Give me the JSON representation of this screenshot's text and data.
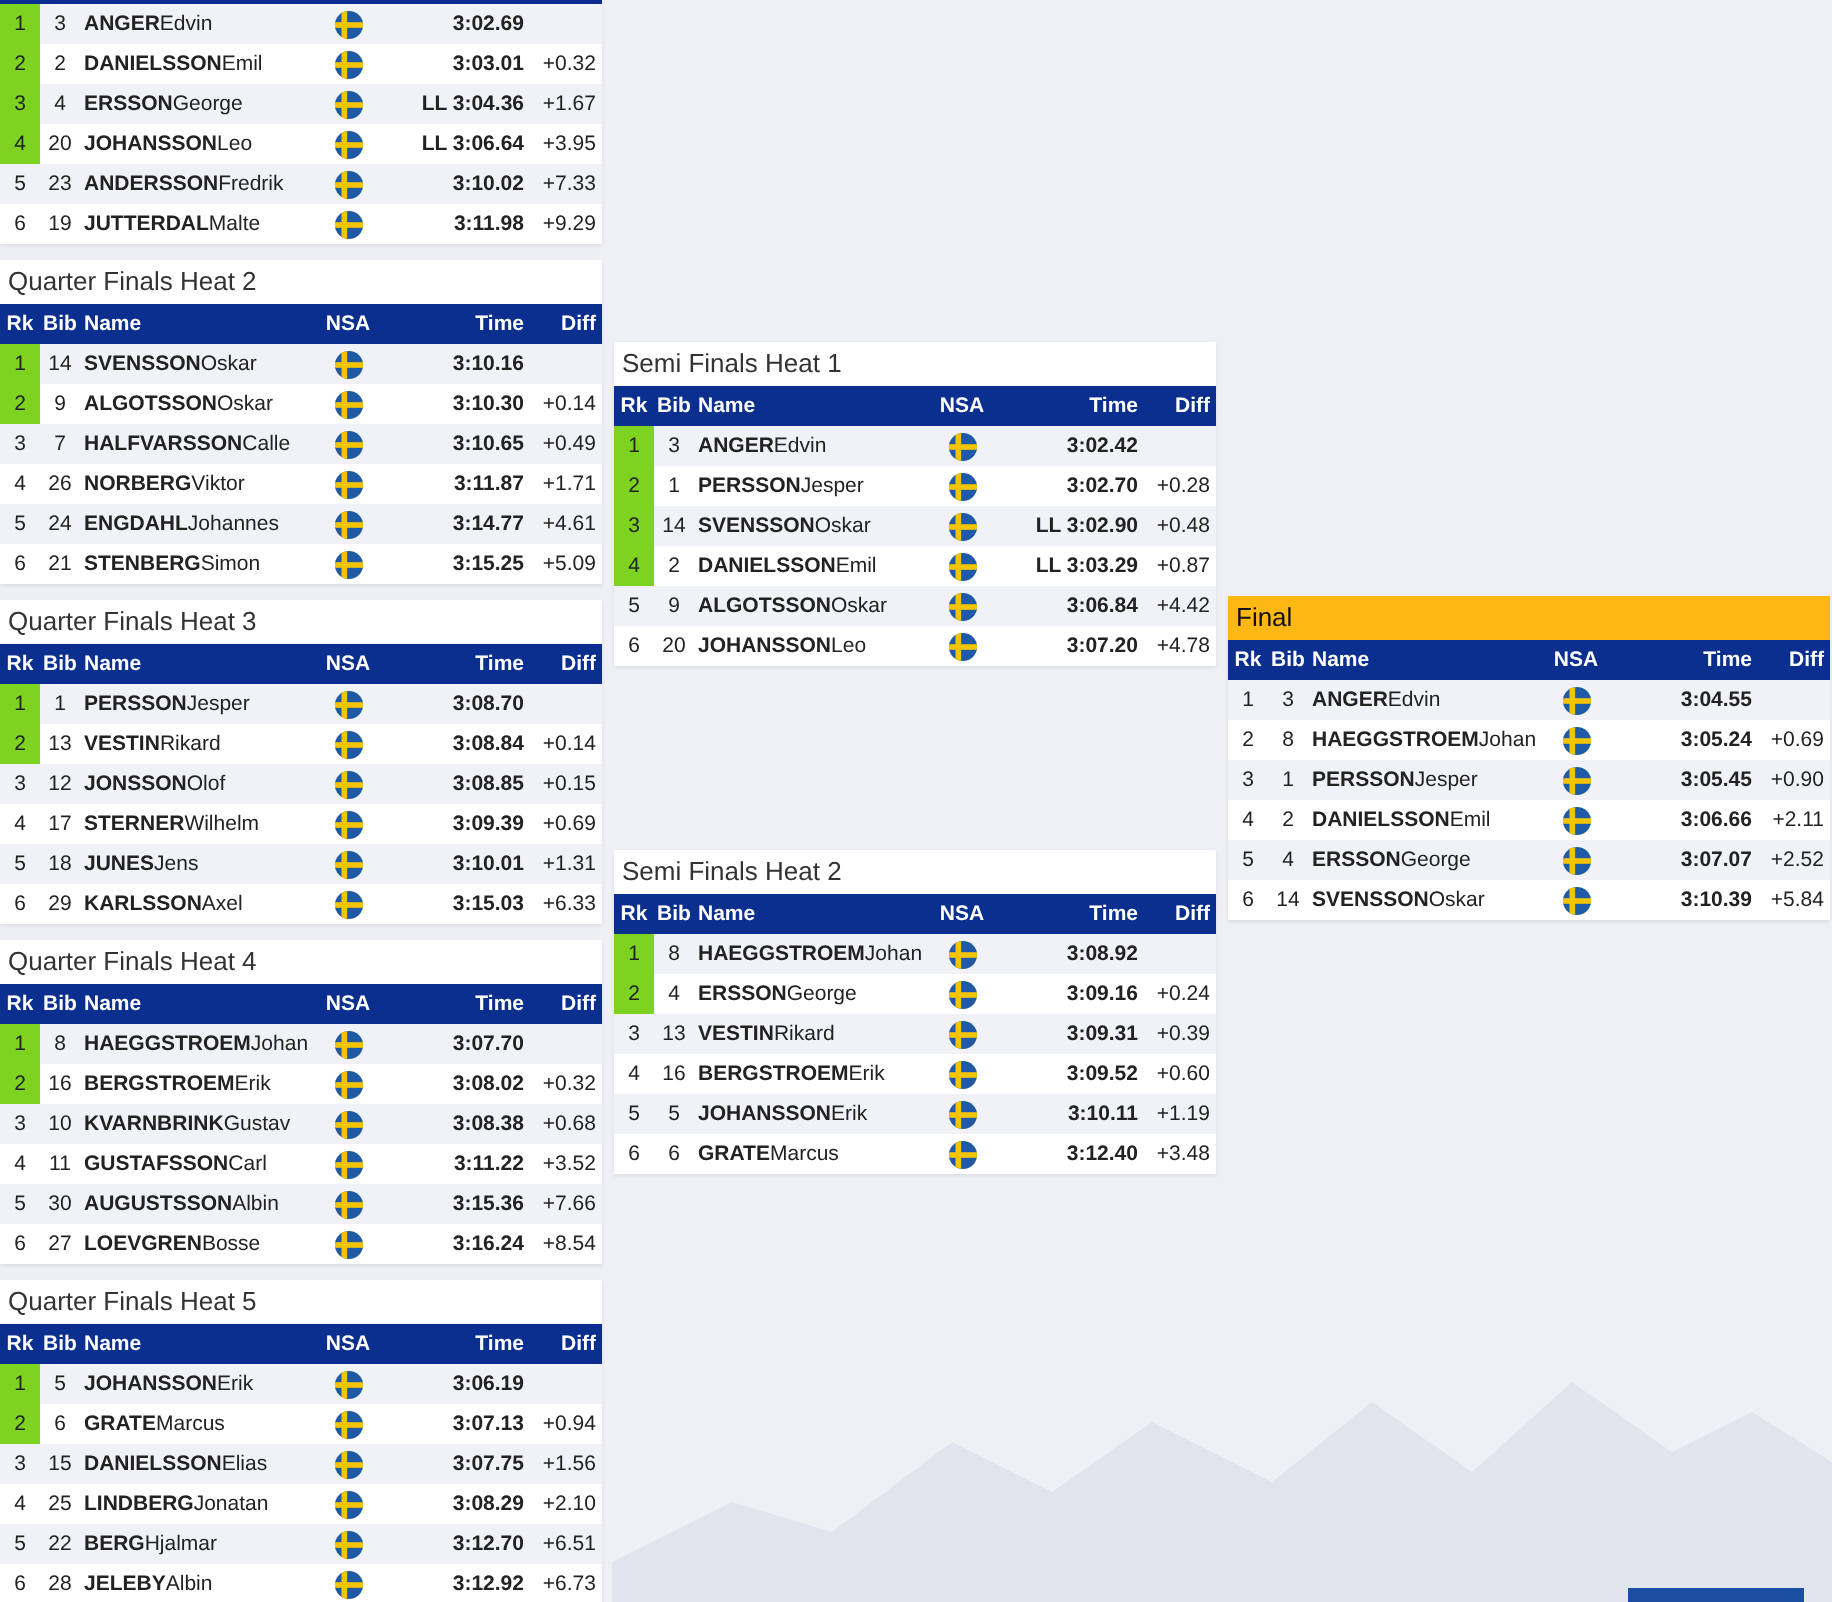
{
  "columns": [
    {
      "heats": [
        {
          "rows": [
            {
              "rank": "1",
              "bib": "3",
              "last": "ANGER",
              "first": "Edvin",
              "time": "3:02.69",
              "qualified": true
            },
            {
              "rank": "2",
              "bib": "2",
              "last": "DANIELSSON",
              "first": "Emil",
              "time": "3:03.01",
              "diff": "+0.32",
              "qualified": true
            },
            {
              "rank": "3",
              "bib": "4",
              "last": "ERSSON",
              "first": "George",
              "note": "LL",
              "time": "3:04.36",
              "diff": "+1.67",
              "qualified": true
            },
            {
              "rank": "4",
              "bib": "20",
              "last": "JOHANSSON",
              "first": "Leo",
              "note": "LL",
              "time": "3:06.64",
              "diff": "+3.95",
              "qualified": true
            },
            {
              "rank": "5",
              "bib": "23",
              "last": "ANDERSSON",
              "first": "Fredrik",
              "time": "3:10.02",
              "diff": "+7.33",
              "qualified": false
            },
            {
              "rank": "6",
              "bib": "19",
              "last": "JUTTERDAL",
              "first": "Malte",
              "time": "3:11.98",
              "diff": "+9.29",
              "qualified": false
            }
          ]
        },
        {
          "kind": "heat",
          "title": "Quarter Finals Heat 2",
          "columns": [
            "Rk",
            "Bib",
            "Name",
            "NSA",
            "Time",
            "Diff"
          ],
          "rows": [
            {
              "rank": "1",
              "bib": "14",
              "last": "SVENSSON",
              "first": "Oskar",
              "time": "3:10.16",
              "qualified": true
            },
            {
              "rank": "2",
              "bib": "9",
              "last": "ALGOTSSON",
              "first": "Oskar",
              "time": "3:10.30",
              "diff": "+0.14",
              "qualified": true
            },
            {
              "rank": "3",
              "bib": "7",
              "last": "HALFVARSSON",
              "first": "Calle",
              "time": "3:10.65",
              "diff": "+0.49",
              "qualified": false
            },
            {
              "rank": "4",
              "bib": "26",
              "last": "NORBERG",
              "first": "Viktor",
              "time": "3:11.87",
              "diff": "+1.71",
              "qualified": false
            },
            {
              "rank": "5",
              "bib": "24",
              "last": "ENGDAHL",
              "first": "Johannes",
              "time": "3:14.77",
              "diff": "+4.61",
              "qualified": false
            },
            {
              "rank": "6",
              "bib": "21",
              "last": "STENBERG",
              "first": "Simon",
              "time": "3:15.25",
              "diff": "+5.09",
              "qualified": false
            }
          ]
        },
        {
          "kind": "heat",
          "title": "Quarter Finals Heat 3",
          "columns": [
            "Rk",
            "Bib",
            "Name",
            "NSA",
            "Time",
            "Diff"
          ],
          "rows": [
            {
              "rank": "1",
              "bib": "1",
              "last": "PERSSON",
              "first": "Jesper",
              "time": "3:08.70",
              "qualified": true
            },
            {
              "rank": "2",
              "bib": "13",
              "last": "VESTIN",
              "first": "Rikard",
              "time": "3:08.84",
              "diff": "+0.14",
              "qualified": true
            },
            {
              "rank": "3",
              "bib": "12",
              "last": "JONSSON",
              "first": "Olof",
              "time": "3:08.85",
              "diff": "+0.15",
              "qualified": false
            },
            {
              "rank": "4",
              "bib": "17",
              "last": "STERNER",
              "first": "Wilhelm",
              "time": "3:09.39",
              "diff": "+0.69",
              "qualified": false
            },
            {
              "rank": "5",
              "bib": "18",
              "last": "JUNES",
              "first": "Jens",
              "time": "3:10.01",
              "diff": "+1.31",
              "qualified": false
            },
            {
              "rank": "6",
              "bib": "29",
              "last": "KARLSSON",
              "first": "Axel",
              "time": "3:15.03",
              "diff": "+6.33",
              "qualified": false
            }
          ]
        },
        {
          "kind": "heat",
          "title": "Quarter Finals Heat 4",
          "columns": [
            "Rk",
            "Bib",
            "Name",
            "NSA",
            "Time",
            "Diff"
          ],
          "rows": [
            {
              "rank": "1",
              "bib": "8",
              "last": "HAEGGSTROEM",
              "first": "Johan",
              "time": "3:07.70",
              "qualified": true
            },
            {
              "rank": "2",
              "bib": "16",
              "last": "BERGSTROEM",
              "first": "Erik",
              "time": "3:08.02",
              "diff": "+0.32",
              "qualified": true
            },
            {
              "rank": "3",
              "bib": "10",
              "last": "KVARNBRINK",
              "first": "Gustav",
              "time": "3:08.38",
              "diff": "+0.68",
              "qualified": false
            },
            {
              "rank": "4",
              "bib": "11",
              "last": "GUSTAFSSON",
              "first": "Carl",
              "time": "3:11.22",
              "diff": "+3.52",
              "qualified": false
            },
            {
              "rank": "5",
              "bib": "30",
              "last": "AUGUSTSSON",
              "first": "Albin",
              "time": "3:15.36",
              "diff": "+7.66",
              "qualified": false
            },
            {
              "rank": "6",
              "bib": "27",
              "last": "LOEVGREN",
              "first": "Bosse",
              "time": "3:16.24",
              "diff": "+8.54",
              "qualified": false
            }
          ]
        },
        {
          "kind": "heat",
          "title": "Quarter Finals Heat 5",
          "columns": [
            "Rk",
            "Bib",
            "Name",
            "NSA",
            "Time",
            "Diff"
          ],
          "rows": [
            {
              "rank": "1",
              "bib": "5",
              "last": "JOHANSSON",
              "first": "Erik",
              "time": "3:06.19",
              "qualified": true
            },
            {
              "rank": "2",
              "bib": "6",
              "last": "GRATE",
              "first": "Marcus",
              "time": "3:07.13",
              "diff": "+0.94",
              "qualified": true
            },
            {
              "rank": "3",
              "bib": "15",
              "last": "DANIELSSON",
              "first": "Elias",
              "time": "3:07.75",
              "diff": "+1.56",
              "qualified": false
            },
            {
              "rank": "4",
              "bib": "25",
              "last": "LINDBERG",
              "first": "Jonatan",
              "time": "3:08.29",
              "diff": "+2.10",
              "qualified": false
            },
            {
              "rank": "5",
              "bib": "22",
              "last": "BERG",
              "first": "Hjalmar",
              "time": "3:12.70",
              "diff": "+6.51",
              "qualified": false
            },
            {
              "rank": "6",
              "bib": "28",
              "last": "JELEBY",
              "first": "Albin",
              "time": "3:12.92",
              "diff": "+6.73",
              "qualified": false
            }
          ]
        }
      ]
    },
    {
      "heats": [
        {
          "kind": "heat",
          "title": "Semi Finals Heat 1",
          "columns": [
            "Rk",
            "Bib",
            "Name",
            "NSA",
            "Time",
            "Diff"
          ],
          "rows": [
            {
              "rank": "1",
              "bib": "3",
              "last": "ANGER",
              "first": "Edvin",
              "time": "3:02.42",
              "qualified": true
            },
            {
              "rank": "2",
              "bib": "1",
              "last": "PERSSON",
              "first": "Jesper",
              "time": "3:02.70",
              "diff": "+0.28",
              "qualified": true
            },
            {
              "rank": "3",
              "bib": "14",
              "last": "SVENSSON",
              "first": "Oskar",
              "note": "LL",
              "time": "3:02.90",
              "diff": "+0.48",
              "qualified": true
            },
            {
              "rank": "4",
              "bib": "2",
              "last": "DANIELSSON",
              "first": "Emil",
              "note": "LL",
              "time": "3:03.29",
              "diff": "+0.87",
              "qualified": true
            },
            {
              "rank": "5",
              "bib": "9",
              "last": "ALGOTSSON",
              "first": "Oskar",
              "time": "3:06.84",
              "diff": "+4.42",
              "qualified": false
            },
            {
              "rank": "6",
              "bib": "20",
              "last": "JOHANSSON",
              "first": "Leo",
              "time": "3:07.20",
              "diff": "+4.78",
              "qualified": false
            }
          ]
        },
        {
          "kind": "heat",
          "title": "Semi Finals Heat 2",
          "columns": [
            "Rk",
            "Bib",
            "Name",
            "NSA",
            "Time",
            "Diff"
          ],
          "rows": [
            {
              "rank": "1",
              "bib": "8",
              "last": "HAEGGSTROEM",
              "first": "Johan",
              "time": "3:08.92",
              "qualified": true
            },
            {
              "rank": "2",
              "bib": "4",
              "last": "ERSSON",
              "first": "George",
              "time": "3:09.16",
              "diff": "+0.24",
              "qualified": true
            },
            {
              "rank": "3",
              "bib": "13",
              "last": "VESTIN",
              "first": "Rikard",
              "time": "3:09.31",
              "diff": "+0.39",
              "qualified": false
            },
            {
              "rank": "4",
              "bib": "16",
              "last": "BERGSTROEM",
              "first": "Erik",
              "time": "3:09.52",
              "diff": "+0.60",
              "qualified": false
            },
            {
              "rank": "5",
              "bib": "5",
              "last": "JOHANSSON",
              "first": "Erik",
              "time": "3:10.11",
              "diff": "+1.19",
              "qualified": false
            },
            {
              "rank": "6",
              "bib": "6",
              "last": "GRATE",
              "first": "Marcus",
              "time": "3:12.40",
              "diff": "+3.48",
              "qualified": false
            }
          ]
        }
      ]
    },
    {
      "heats": [
        {
          "kind": "final",
          "title": "Final",
          "columns": [
            "Rk",
            "Bib",
            "Name",
            "NSA",
            "Time",
            "Diff"
          ],
          "rows": [
            {
              "rank": "1",
              "bib": "3",
              "last": "ANGER",
              "first": "Edvin",
              "time": "3:04.55",
              "qualified": false
            },
            {
              "rank": "2",
              "bib": "8",
              "last": "HAEGGSTROEM",
              "first": "Johan",
              "time": "3:05.24",
              "diff": "+0.69",
              "qualified": false
            },
            {
              "rank": "3",
              "bib": "1",
              "last": "PERSSON",
              "first": "Jesper",
              "time": "3:05.45",
              "diff": "+0.90",
              "qualified": false
            },
            {
              "rank": "4",
              "bib": "2",
              "last": "DANIELSSON",
              "first": "Emil",
              "time": "3:06.66",
              "diff": "+2.11",
              "qualified": false
            },
            {
              "rank": "5",
              "bib": "4",
              "last": "ERSSON",
              "first": "George",
              "time": "3:07.07",
              "diff": "+2.52",
              "qualified": false
            },
            {
              "rank": "6",
              "bib": "14",
              "last": "SVENSSON",
              "first": "Oskar",
              "time": "3:10.39",
              "diff": "+5.84",
              "qualified": false
            }
          ]
        }
      ]
    }
  ]
}
